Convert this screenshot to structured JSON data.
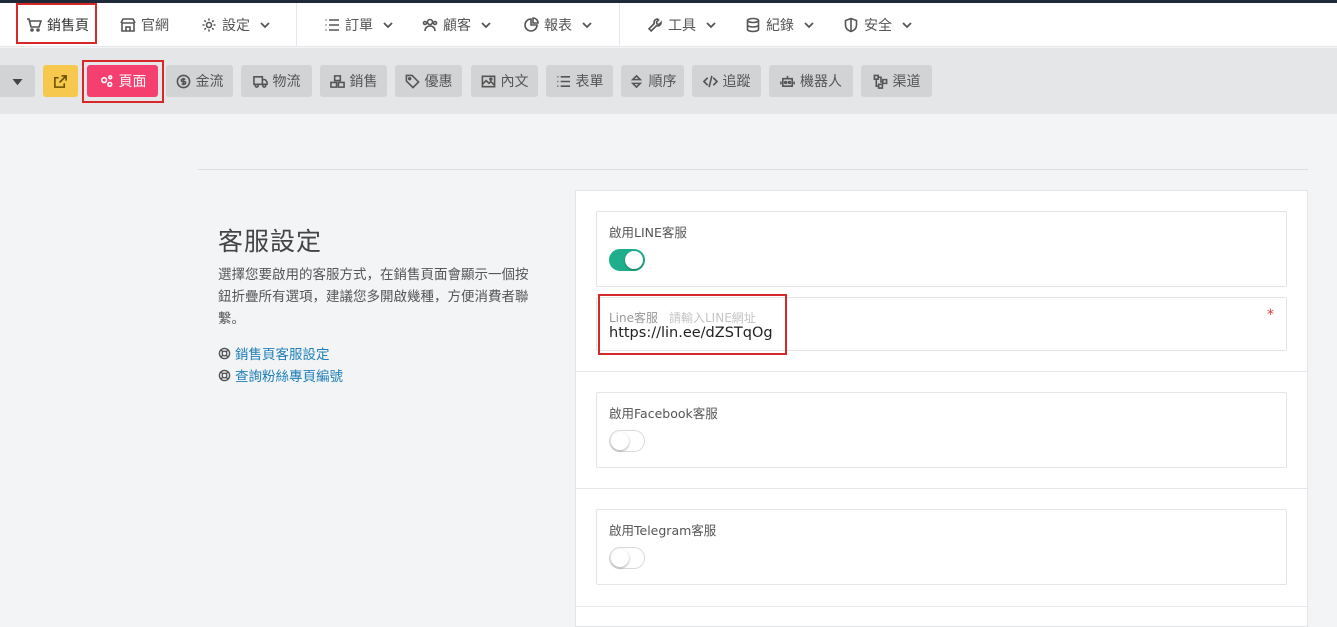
{
  "topnav": {
    "items": [
      {
        "label": "銷售頁",
        "icon": "cart-icon"
      },
      {
        "label": "官網",
        "icon": "store-icon"
      },
      {
        "label": "設定",
        "icon": "gear-icon"
      },
      {
        "label": "訂單",
        "icon": "list-icon"
      },
      {
        "label": "顧客",
        "icon": "users-icon"
      },
      {
        "label": "報表",
        "icon": "pie-chart-icon"
      },
      {
        "label": "工具",
        "icon": "wrench-icon"
      },
      {
        "label": "紀錄",
        "icon": "database-icon"
      },
      {
        "label": "安全",
        "icon": "shield-icon"
      }
    ]
  },
  "toolbar": {
    "buttons": [
      {
        "label": "頁面",
        "icon": "cogs-icon",
        "active": true
      },
      {
        "label": "金流",
        "icon": "dollar-icon"
      },
      {
        "label": "物流",
        "icon": "truck-icon"
      },
      {
        "label": "銷售",
        "icon": "boxes-icon"
      },
      {
        "label": "優惠",
        "icon": "tag-icon"
      },
      {
        "label": "內文",
        "icon": "image-icon"
      },
      {
        "label": "表單",
        "icon": "list-icon"
      },
      {
        "label": "順序",
        "icon": "sort-icon"
      },
      {
        "label": "追蹤",
        "icon": "code-icon"
      },
      {
        "label": "機器人",
        "icon": "robot-icon"
      },
      {
        "label": "渠道",
        "icon": "sitemap-icon"
      }
    ]
  },
  "section": {
    "title": "客服設定",
    "description": "選擇您要啟用的客服方式，在銷售頁面會顯示一個按鈕折疊所有選項，建議您多開啟幾種，方便消費者聯繫。",
    "links": [
      {
        "label": "銷售頁客服設定",
        "icon": "lifebuoy-icon"
      },
      {
        "label": "查詢粉絲專頁編號",
        "icon": "lifebuoy-icon"
      }
    ]
  },
  "form": {
    "line_enable_label": "啟用LINE客服",
    "line_enabled": true,
    "line_field_label": "Line客服",
    "line_placeholder": "請輸入LINE網址",
    "line_value": "https://lin.ee/dZSTqOg",
    "required_mark": "*",
    "facebook_enable_label": "啟用Facebook客服",
    "facebook_enabled": false,
    "telegram_enable_label": "啟用Telegram客服",
    "telegram_enabled": false
  },
  "colors": {
    "accent": "#f43f6f",
    "toggle_on": "#1fae8c",
    "link": "#1e7fb8",
    "highlight": "#d62828",
    "yellow_button": "#f6c94e"
  }
}
